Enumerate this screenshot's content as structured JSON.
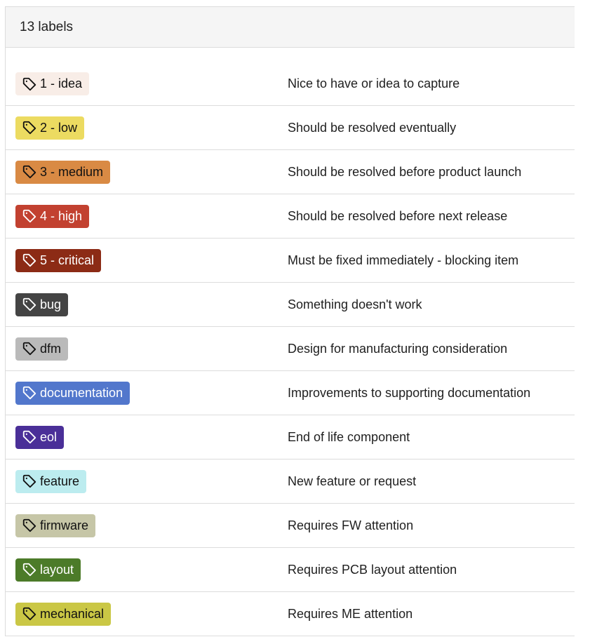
{
  "header": {
    "title": "13 labels"
  },
  "labels": [
    {
      "name": "1 - idea",
      "description": "Nice to have or idea to capture",
      "bg": "#f8ede7",
      "fg": "#111111"
    },
    {
      "name": "2 - low",
      "description": "Should be resolved eventually",
      "bg": "#ecdb61",
      "fg": "#111111"
    },
    {
      "name": "3 - medium",
      "description": "Should be resolved before product launch",
      "bg": "#d98a44",
      "fg": "#111111"
    },
    {
      "name": "4 - high",
      "description": "Should be resolved before next release",
      "bg": "#c24130",
      "fg": "#ffffff"
    },
    {
      "name": "5 - critical",
      "description": "Must be fixed immediately - blocking item",
      "bg": "#8c2b15",
      "fg": "#ffffff"
    },
    {
      "name": "bug",
      "description": "Something doesn't work",
      "bg": "#444444",
      "fg": "#ffffff"
    },
    {
      "name": "dfm",
      "description": "Design for manufacturing consideration",
      "bg": "#bababa",
      "fg": "#111111"
    },
    {
      "name": "documentation",
      "description": "Improvements to supporting documentation",
      "bg": "#5277cc",
      "fg": "#ffffff"
    },
    {
      "name": "eol",
      "description": "End of life component",
      "bg": "#4a2f98",
      "fg": "#ffffff"
    },
    {
      "name": "feature",
      "description": "New feature or request",
      "bg": "#bcecef",
      "fg": "#111111"
    },
    {
      "name": "firmware",
      "description": "Requires FW attention",
      "bg": "#c6c6a7",
      "fg": "#111111"
    },
    {
      "name": "layout",
      "description": "Requires PCB layout attention",
      "bg": "#4c7b29",
      "fg": "#ffffff"
    },
    {
      "name": "mechanical",
      "description": "Requires ME attention",
      "bg": "#cac745",
      "fg": "#111111"
    }
  ],
  "icons": {
    "label": "tag-icon"
  }
}
